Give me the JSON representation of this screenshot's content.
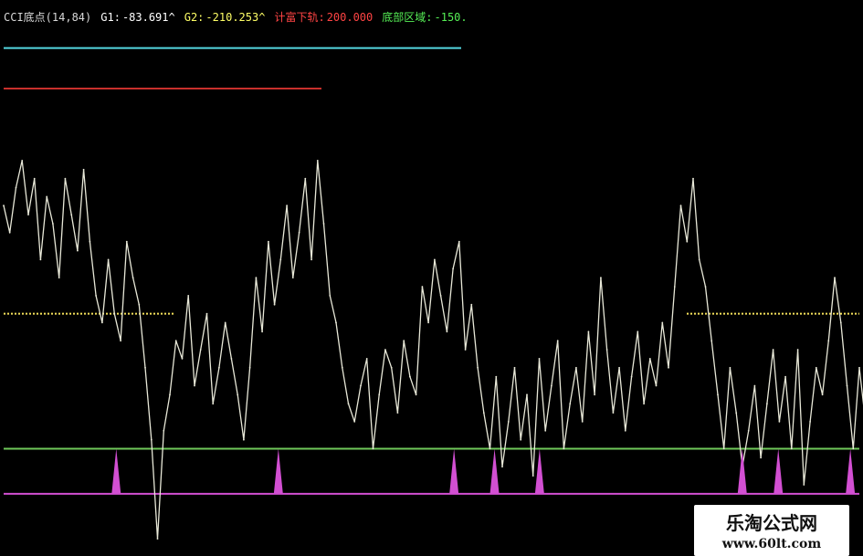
{
  "header": {
    "indicator": "CCI底点(14,84)",
    "g1_label": "G1:",
    "g1_value": "-83.691^",
    "g2_label": "G2:",
    "g2_value": "-210.253^",
    "overbought_label": "计富下轨:",
    "overbought_value": "200.000",
    "bottom_label": "底部区域:",
    "bottom_value": "-150."
  },
  "watermark": {
    "cn": "乐淘公式网",
    "url": "www.60lt.com"
  },
  "colors": {
    "background": "#000000",
    "cci_line": "#e8e8d8",
    "upper_cyan": "#53d6e0",
    "red_level": "#c8302c",
    "zero_dotted": "#f5e15a",
    "green_level": "#6fc85a",
    "magenta_signal": "#d24fd2",
    "g1_color": "#ffffff",
    "g2_color": "#ffff66",
    "overbought_color": "#ff4444",
    "bottom_color": "#55ee55"
  },
  "chart_data": {
    "type": "line",
    "title": "CCI底点(14,84)",
    "xlabel": "",
    "ylabel": "",
    "ylim": [
      -260,
      320
    ],
    "x": [
      0,
      1,
      2,
      3,
      4,
      5,
      6,
      7,
      8,
      9,
      10,
      11,
      12,
      13,
      14,
      15,
      16,
      17,
      18,
      19,
      20,
      21,
      22,
      23,
      24,
      25,
      26,
      27,
      28,
      29,
      30,
      31,
      32,
      33,
      34,
      35,
      36,
      37,
      38,
      39,
      40,
      41,
      42,
      43,
      44,
      45,
      46,
      47,
      48,
      49,
      50,
      51,
      52,
      53,
      54,
      55,
      56,
      57,
      58,
      59,
      60,
      61,
      62,
      63,
      64,
      65,
      66,
      67,
      68,
      69,
      70,
      71,
      72,
      73,
      74,
      75,
      76,
      77,
      78,
      79,
      80,
      81,
      82,
      83,
      84,
      85,
      86,
      87,
      88,
      89,
      90,
      91,
      92,
      93,
      94,
      95,
      96,
      97,
      98,
      99,
      100,
      101,
      102,
      103,
      104,
      105,
      106,
      107,
      108,
      109,
      110,
      111,
      112,
      113,
      114,
      115,
      116,
      117,
      118,
      119,
      120,
      121,
      122,
      123,
      124,
      125,
      126,
      127,
      128,
      129,
      130,
      131,
      132,
      133,
      134,
      135,
      136,
      137,
      138,
      139
    ],
    "series": [
      {
        "values": [
          120,
          90,
          140,
          170,
          110,
          150,
          60,
          130,
          100,
          40,
          150,
          110,
          70,
          160,
          80,
          20,
          -10,
          60,
          0,
          -30,
          80,
          40,
          10,
          -60,
          -140,
          -250,
          -130,
          -90,
          -30,
          -50,
          20,
          -80,
          -40,
          0,
          -100,
          -60,
          -10,
          -50,
          -90,
          -140,
          -60,
          40,
          -20,
          80,
          10,
          60,
          120,
          40,
          90,
          150,
          60,
          170,
          100,
          20,
          -10,
          -60,
          -100,
          -120,
          -80,
          -50,
          -150,
          -90,
          -40,
          -60,
          -110,
          -30,
          -70,
          -90,
          30,
          -10,
          60,
          20,
          -20,
          50,
          80,
          -40,
          10,
          -60,
          -110,
          -150,
          -70,
          -170,
          -120,
          -60,
          -140,
          -90,
          -180,
          -50,
          -130,
          -80,
          -30,
          -150,
          -100,
          -60,
          -120,
          -20,
          -90,
          40,
          -40,
          -110,
          -60,
          -130,
          -70,
          -20,
          -100,
          -50,
          -80,
          -10,
          -60,
          30,
          120,
          80,
          150,
          60,
          30,
          -30,
          -90,
          -150,
          -60,
          -110,
          -170,
          -130,
          -80,
          -160,
          -100,
          -40,
          -120,
          -70,
          -150,
          -40,
          -190,
          -120,
          -60,
          -90,
          -30,
          40,
          -10,
          -80,
          -150,
          -60,
          -120,
          -180
        ]
      }
    ],
    "levels": {
      "upper_cyan": 295,
      "red": 250,
      "zero": 0,
      "green": -150,
      "magenta_base": -200
    },
    "signals": [
      {
        "x": 25,
        "value": -150
      },
      {
        "x": 61,
        "value": -150
      },
      {
        "x": 100,
        "value": -150
      },
      {
        "x": 109,
        "value": -150
      },
      {
        "x": 119,
        "value": -150
      },
      {
        "x": 164,
        "value": -150
      },
      {
        "x": 172,
        "value": -150
      },
      {
        "x": 188,
        "value": -150
      }
    ]
  }
}
